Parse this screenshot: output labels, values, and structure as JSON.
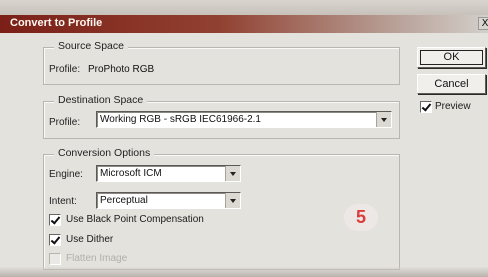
{
  "dialog": {
    "title": "Convert to Profile",
    "close_label": "X"
  },
  "source_space": {
    "legend": "Source Space",
    "profile_label": "Profile:",
    "profile_value": "ProPhoto RGB"
  },
  "destination_space": {
    "legend": "Destination Space",
    "profile_label": "Profile:",
    "selected_profile": "Working RGB - sRGB IEC61966-2.1"
  },
  "conversion_options": {
    "legend": "Conversion Options",
    "engine_label": "Engine:",
    "engine_value": "Microsoft ICM",
    "intent_label": "Intent:",
    "intent_value": "Perceptual",
    "black_point_label": "Use Black Point Compensation",
    "black_point_checked": true,
    "dither_label": "Use Dither",
    "dither_checked": true,
    "flatten_label": "Flatten Image",
    "flatten_checked": false,
    "flatten_enabled": false
  },
  "buttons": {
    "ok": "OK",
    "cancel": "Cancel"
  },
  "preview": {
    "label": "Preview",
    "checked": true
  },
  "annotation": {
    "step_number": "5",
    "color": "#d93d3c"
  },
  "colors": {
    "dialog_background": "#e4e2dd",
    "titlebar_start": "#7b1f17",
    "titlebar_end": "#d3cfca"
  },
  "icons": {
    "dropdown": "chevron-down-icon",
    "checkbox": "checkmark-icon",
    "close": "close-icon"
  }
}
